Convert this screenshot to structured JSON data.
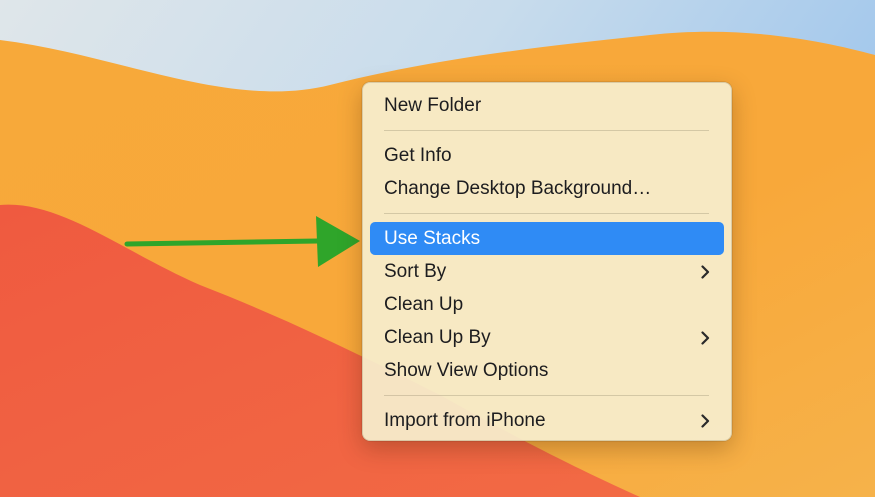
{
  "desktop": {
    "wallpaper_colors": {
      "sky": "#b9d6ee",
      "orange": "#f5a23a",
      "red": "#ef5a42"
    }
  },
  "annotation": {
    "arrow_color": "#2fa52a",
    "icon": "arrow-right-icon"
  },
  "context_menu": {
    "highlight_color": "#2f8bf5",
    "groups": [
      {
        "items": [
          {
            "label": "New Folder",
            "has_submenu": false,
            "highlighted": false
          }
        ]
      },
      {
        "items": [
          {
            "label": "Get Info",
            "has_submenu": false,
            "highlighted": false
          },
          {
            "label": "Change Desktop Background…",
            "has_submenu": false,
            "highlighted": false
          }
        ]
      },
      {
        "items": [
          {
            "label": "Use Stacks",
            "has_submenu": false,
            "highlighted": true
          },
          {
            "label": "Sort By",
            "has_submenu": true,
            "highlighted": false
          },
          {
            "label": "Clean Up",
            "has_submenu": false,
            "highlighted": false
          },
          {
            "label": "Clean Up By",
            "has_submenu": true,
            "highlighted": false
          },
          {
            "label": "Show View Options",
            "has_submenu": false,
            "highlighted": false
          }
        ]
      },
      {
        "items": [
          {
            "label": "Import from iPhone",
            "has_submenu": true,
            "highlighted": false
          }
        ]
      }
    ]
  }
}
